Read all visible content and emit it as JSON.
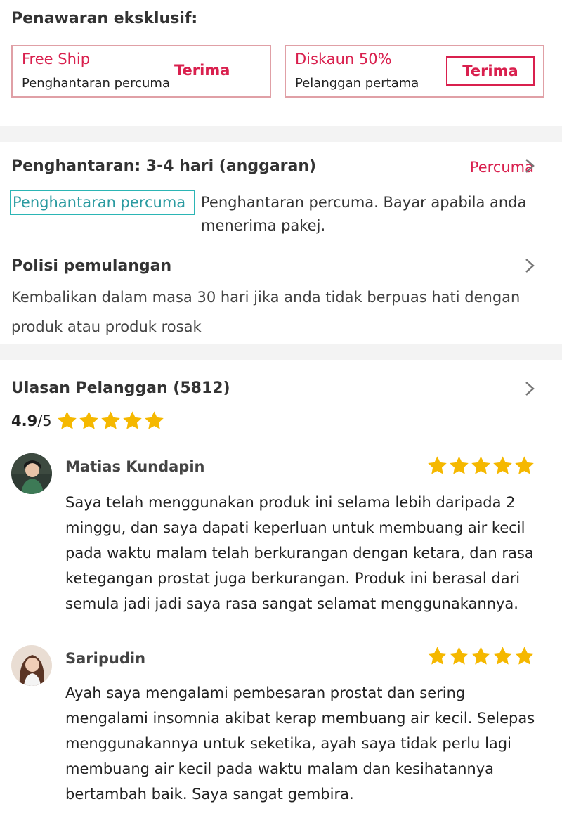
{
  "offers": {
    "title": "Penawaran eksklusif:",
    "coupons": [
      {
        "title": "Free Ship",
        "desc": "Penghantaran percuma",
        "button": "Terima"
      },
      {
        "title": "Diskaun 50%",
        "desc": "Pelanggan pertama",
        "button": "Terima"
      }
    ]
  },
  "shipping": {
    "title": "Penghantaran: 3-4 hari (anggaran)",
    "price": "Percuma",
    "tag": "Penghantaran percuma",
    "desc": "Penghantaran percuma. Bayar apabila anda menerima pakej."
  },
  "returns": {
    "title": "Polisi pemulangan",
    "desc": "Kembalikan dalam masa 30 hari jika anda tidak berpuas hati dengan produk atau produk rosak"
  },
  "reviews": {
    "title": "Ulasan Pelanggan (5812)",
    "score": "4.9",
    "score_suffix": "/5",
    "rating_stars": 5,
    "items": [
      {
        "name": "Matias Kundapin",
        "stars": 5,
        "text": "Saya telah menggunakan produk ini selama lebih daripada 2 minggu, dan saya dapati keperluan untuk membuang air kecil pada waktu malam telah berkurangan dengan ketara, dan rasa ketegangan prostat juga berkurangan. Produk ini berasal dari semula jadi jadi saya rasa sangat selamat menggunakannya."
      },
      {
        "name": "Saripudin",
        "stars": 5,
        "text": "Ayah saya mengalami pembesaran prostat dan sering mengalami insomnia akibat kerap membuang air kecil. Selepas menggunakannya untuk seketika, ayah saya tidak perlu lagi membuang air kecil pada waktu malam dan kesihatannya bertambah baik. Saya sangat gembira."
      }
    ]
  },
  "colors": {
    "accent": "#d9204e",
    "teal": "#2bb5b5",
    "star": "#f5b800"
  },
  "icons": {
    "chevron": "chevron-right-icon",
    "star": "star-icon",
    "avatar": "user-avatar"
  }
}
